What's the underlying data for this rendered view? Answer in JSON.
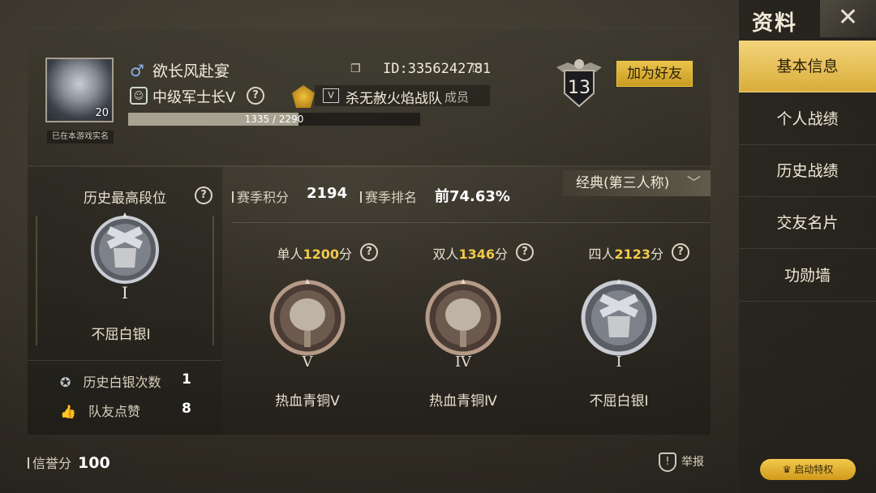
{
  "profile": {
    "avatar_level": "20",
    "realname_tag": "已在本游戏实名",
    "gender_symbol": "♂",
    "username": "欲长风赴宴",
    "rank_title": "中级军士长Ⅴ",
    "exp_text": "1335 / 2290",
    "exp_progress": 0.583,
    "player_id": "ID:3356242781",
    "clan_name": "杀无赦火焰战队",
    "clan_role": "成员",
    "clan_logo": "V",
    "season_number": "13",
    "add_friend_label": "加为好友"
  },
  "history": {
    "title": "历史最高段位",
    "rank_name": "不屈白银Ⅰ",
    "rank_numeral": "I",
    "silver_count_label": "历史白银次数",
    "silver_count": "1",
    "likes_label": "队友点赞",
    "likes": "8"
  },
  "season": {
    "mode_selector": "经典(第三人称)",
    "points_label": "赛季积分",
    "points": "2194",
    "ranking_label": "赛季排名",
    "ranking": "前74.63%"
  },
  "modes": [
    {
      "prefix": "单人",
      "points": "1200",
      "suffix": "分",
      "rank_name": "热血青铜Ⅴ",
      "numeral": "V"
    },
    {
      "prefix": "双人",
      "points": "1346",
      "suffix": "分",
      "rank_name": "热血青铜Ⅳ",
      "numeral": "IV"
    },
    {
      "prefix": "四人",
      "points": "2123",
      "suffix": "分",
      "rank_name": "不屈白银Ⅰ",
      "numeral": "I"
    }
  ],
  "footer": {
    "credit_label": "信誉分",
    "credit_value": "100",
    "report_label": "举报"
  },
  "sidebar": {
    "title": "资料",
    "items": [
      {
        "label": "基本信息"
      },
      {
        "label": "个人战绩"
      },
      {
        "label": "历史战绩"
      },
      {
        "label": "交友名片"
      },
      {
        "label": "功勋墙"
      }
    ],
    "privilege_label": "启动特权"
  },
  "colors": {
    "accent_gold": "#e9c24c",
    "points_yellow": "#f2c74a"
  }
}
